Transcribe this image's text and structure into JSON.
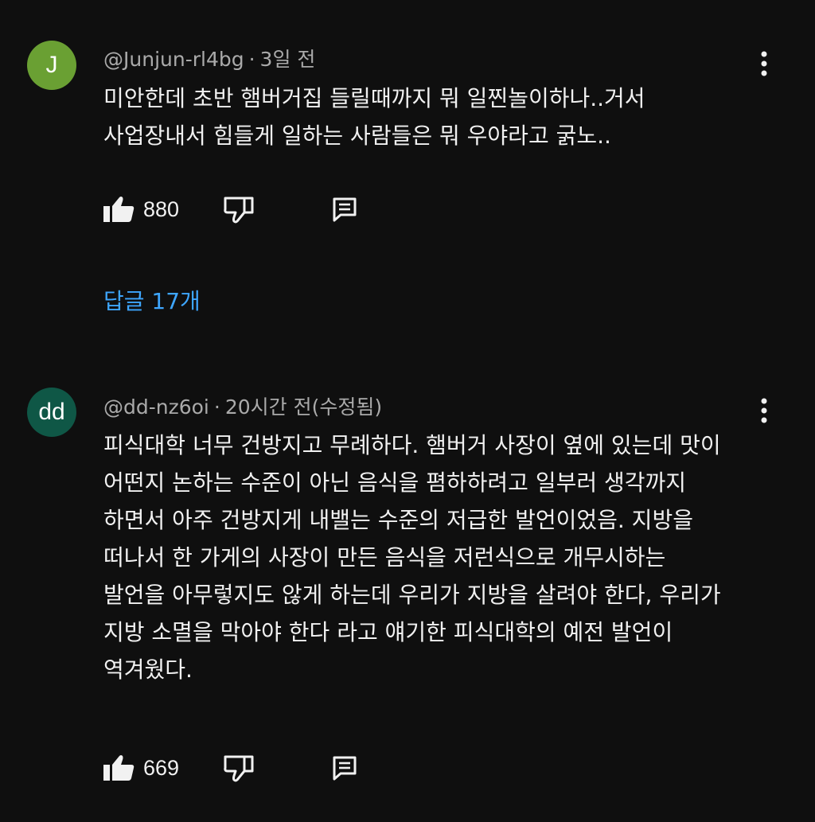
{
  "comments": [
    {
      "avatar_letter": "J",
      "avatar_color": "#6aa033",
      "author": "@Junjun-rl4bg",
      "time": "3일 전",
      "lines": [
        "미안한데 초반 햄버거집 들릴때까지 뭐 일찐놀이하나..거서",
        "사업장내서 힘들게 일하는 사람들은 뭐 우야라고 굵노.."
      ],
      "likes": "880",
      "replies_label": "답글 17개"
    },
    {
      "avatar_letter": "dd",
      "avatar_color": "#0f5746",
      "author": "@dd-nz6oi",
      "time": "20시간 전(수정됨)",
      "lines": [
        "피식대학 너무 건방지고 무례하다. 햄버거 사장이 옆에 있는데 맛이",
        "어떤지 논하는 수준이 아닌 음식을 폄하하려고 일부러 생각까지",
        "하면서 아주 건방지게 내밸는 수준의 저급한 발언이었음. 지방을",
        "떠나서 한 가게의 사장이 만든 음식을 저런식으로 개무시하는",
        "발언을 아무렇지도 않게 하는데 우리가 지방을 살려야 한다, 우리가",
        "지방 소멸을 막아야 한다 라고 얘기한 피식대학의 예전 발언이",
        "역겨웠다."
      ],
      "likes": "669"
    }
  ],
  "icons": {
    "like": "thumbs-up-icon",
    "dislike": "thumbs-down-icon",
    "reply": "comment-icon",
    "menu": "more-vert-icon"
  },
  "separator": "·"
}
